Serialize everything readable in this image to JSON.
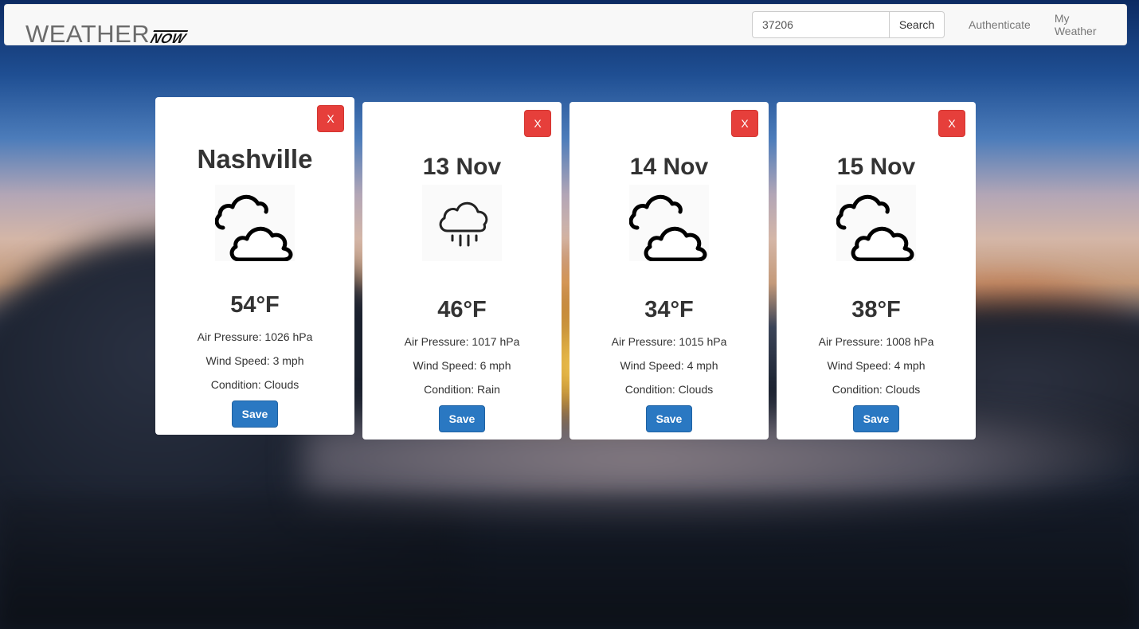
{
  "brand": {
    "main": "WEATHER",
    "accent": "NOW"
  },
  "search": {
    "value": "37206",
    "button_label": "Search"
  },
  "nav": {
    "links": [
      {
        "label": "Authenticate"
      },
      {
        "label": "My Weather"
      }
    ]
  },
  "cards": [
    {
      "title": "Nashville",
      "icon": "clouds-icon",
      "temp": "54°F",
      "pressure": "Air Pressure: 1026 hPa",
      "wind": "Wind Speed: 3 mph",
      "condition": "Condition: Clouds",
      "close_label": "X",
      "save_label": "Save"
    },
    {
      "title": "13 Nov",
      "icon": "rain-icon",
      "temp": "46°F",
      "pressure": "Air Pressure: 1017 hPa",
      "wind": "Wind Speed: 6 mph",
      "condition": "Condition: Rain",
      "close_label": "X",
      "save_label": "Save"
    },
    {
      "title": "14 Nov",
      "icon": "clouds-icon",
      "temp": "34°F",
      "pressure": "Air Pressure: 1015 hPa",
      "wind": "Wind Speed: 4 mph",
      "condition": "Condition: Clouds",
      "close_label": "X",
      "save_label": "Save"
    },
    {
      "title": "15 Nov",
      "icon": "clouds-icon",
      "temp": "38°F",
      "pressure": "Air Pressure: 1008 hPa",
      "wind": "Wind Speed: 4 mph",
      "condition": "Condition: Clouds",
      "close_label": "X",
      "save_label": "Save"
    }
  ],
  "colors": {
    "danger": "#e63f3b",
    "primary": "#2a78c2",
    "navbar_bg": "#f8f8f8"
  }
}
